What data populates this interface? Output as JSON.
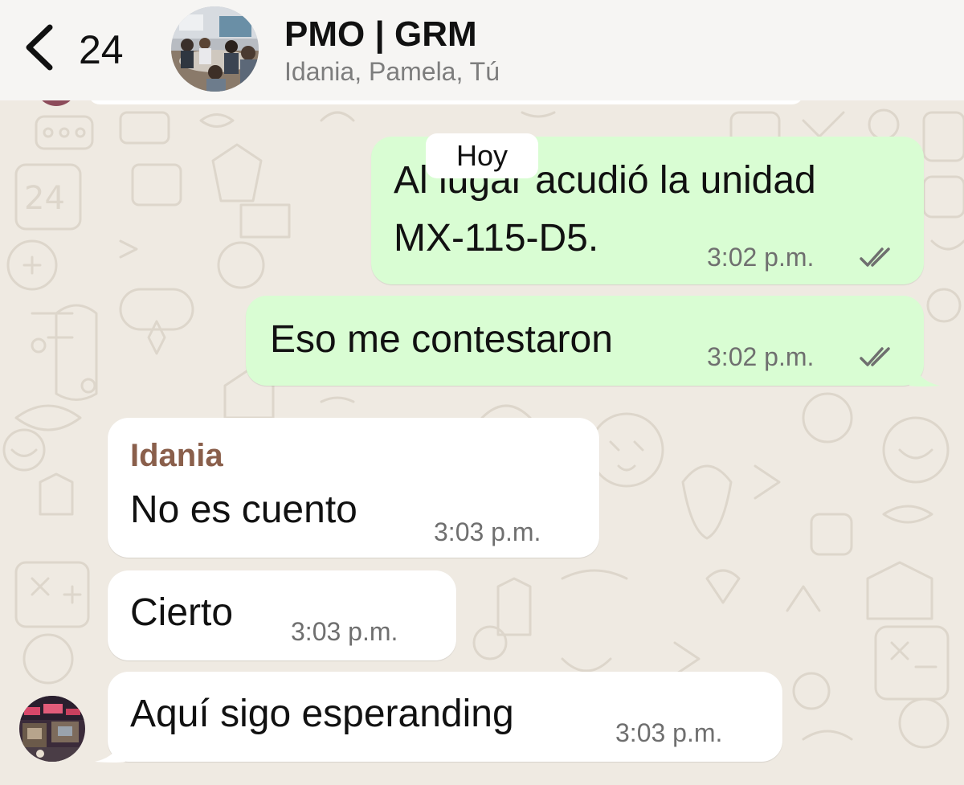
{
  "header": {
    "back_icon": "chevron-left-icon",
    "unread_count": "24",
    "title": "PMO | GRM",
    "members": "Idania, Pamela, Tú",
    "avatar_icon": "group-photo-avatar"
  },
  "date_separator": "Hoy",
  "messages": [
    {
      "direction": "outgoing",
      "lines": [
        "Al lugar acudió la unidad",
        "MX-115-D5."
      ],
      "time": "3:02 p.m.",
      "status_icon": "double-check-icon"
    },
    {
      "direction": "outgoing",
      "lines": [
        "Eso me contestaron"
      ],
      "time": "3:02 p.m.",
      "status_icon": "double-check-icon"
    },
    {
      "direction": "incoming",
      "sender": "Idania",
      "lines": [
        "No es cuento"
      ],
      "time": "3:03 p.m."
    },
    {
      "direction": "incoming",
      "lines": [
        "Cierto"
      ],
      "time": "3:03 p.m."
    },
    {
      "direction": "incoming",
      "lines": [
        "Aquí sigo esperanding"
      ],
      "time": "3:03 p.m.",
      "avatar_icon": "sender-photo-avatar"
    }
  ],
  "colors": {
    "background": "#efeae2",
    "header": "#f6f5f3",
    "outgoing_bubble": "#d9fdd3",
    "incoming_bubble": "#ffffff",
    "sender_name": "#8a5f4b",
    "timestamp": "#6f6f6f"
  }
}
